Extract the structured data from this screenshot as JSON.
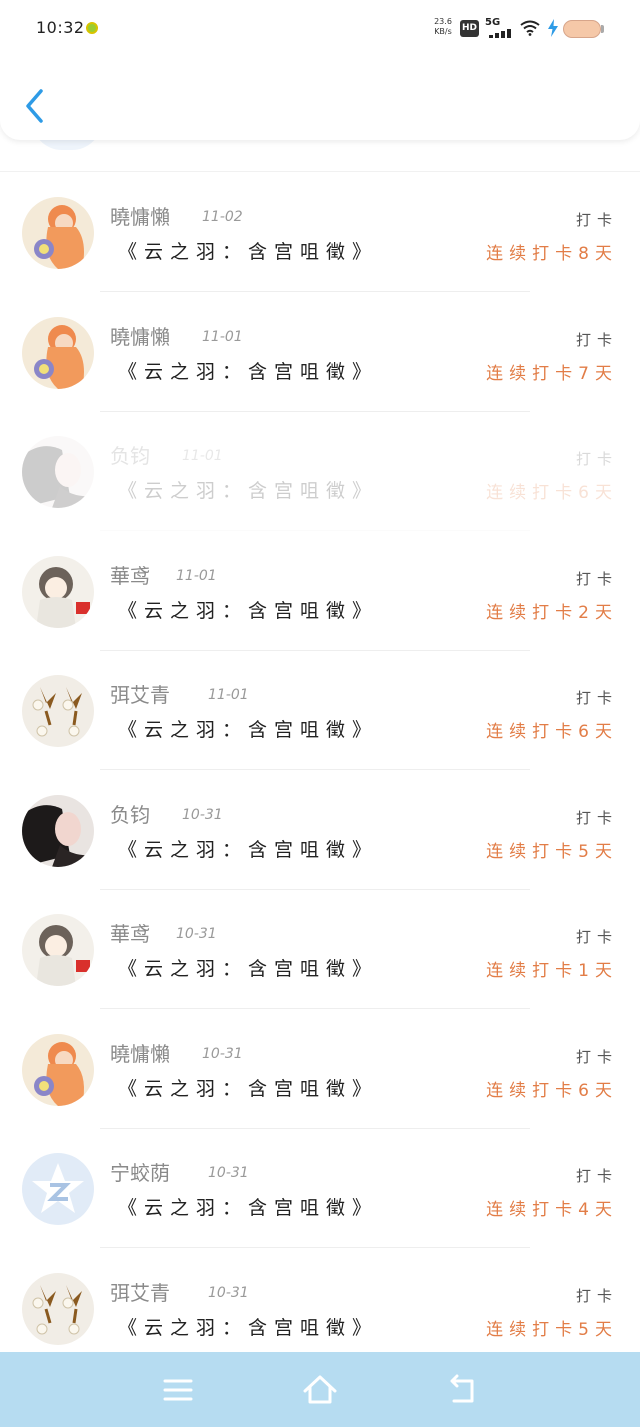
{
  "status_bar": {
    "time": "10:32",
    "net_speed": "23.6 KB/s",
    "hd_label": "HD",
    "network_label": "5G"
  },
  "colors": {
    "accent_back": "#2e9be6",
    "streak_text": "#e27d47",
    "nav_bar_bg": "#b6dcf1"
  },
  "header": {
    "back_icon": "chevron-left-icon"
  },
  "rows": [
    {
      "name": "曉慵懶",
      "date": "11-02",
      "message": "《云之羽：含宫咀徵》",
      "checkin": "打卡",
      "streak": "连续打卡8天",
      "avatar": "avatar-orange-hair-girl",
      "faded": false
    },
    {
      "name": "曉慵懶",
      "date": "11-01",
      "message": "《云之羽：含宫咀徵》",
      "checkin": "打卡",
      "streak": "连续打卡7天",
      "avatar": "avatar-orange-hair-girl",
      "faded": false
    },
    {
      "name": "负钧",
      "date": "11-01",
      "message": "《云之羽：含宫咀徵》",
      "checkin": "打卡",
      "streak": "连续打卡6天",
      "avatar": "avatar-dark-hair-woman",
      "faded": true
    },
    {
      "name": "華鸢",
      "date": "11-01",
      "message": "《云之羽：含宫咀徵》",
      "checkin": "打卡",
      "streak": "连续打卡2天",
      "avatar": "avatar-chibi-girl",
      "faded": false
    },
    {
      "name": "弭艾青",
      "date": "11-01",
      "message": "《云之羽：含宫咀徵》",
      "checkin": "打卡",
      "streak": "连续打卡6天",
      "avatar": "avatar-pearl-earrings",
      "faded": false
    },
    {
      "name": "负钧",
      "date": "10-31",
      "message": "《云之羽：含宫咀徵》",
      "checkin": "打卡",
      "streak": "连续打卡5天",
      "avatar": "avatar-dark-hair-woman",
      "faded": false
    },
    {
      "name": "華鸢",
      "date": "10-31",
      "message": "《云之羽：含宫咀徵》",
      "checkin": "打卡",
      "streak": "连续打卡1天",
      "avatar": "avatar-chibi-girl",
      "faded": false
    },
    {
      "name": "曉慵懶",
      "date": "10-31",
      "message": "《云之羽：含宫咀徵》",
      "checkin": "打卡",
      "streak": "连续打卡6天",
      "avatar": "avatar-orange-hair-girl",
      "faded": false
    },
    {
      "name": "宁蛟荫",
      "date": "10-31",
      "message": "《云之羽：含宫咀徵》",
      "checkin": "打卡",
      "streak": "连续打卡4天",
      "avatar": "avatar-qq-default-star",
      "faded": false
    },
    {
      "name": "弭艾青",
      "date": "10-31",
      "message": "《云之羽：含宫咀徵》",
      "checkin": "打卡",
      "streak": "连续打卡5天",
      "avatar": "avatar-pearl-earrings",
      "faded": false
    }
  ],
  "nav_bar": {
    "menu_icon": "menu-icon",
    "home_icon": "home-icon",
    "back_icon": "back-return-icon"
  }
}
